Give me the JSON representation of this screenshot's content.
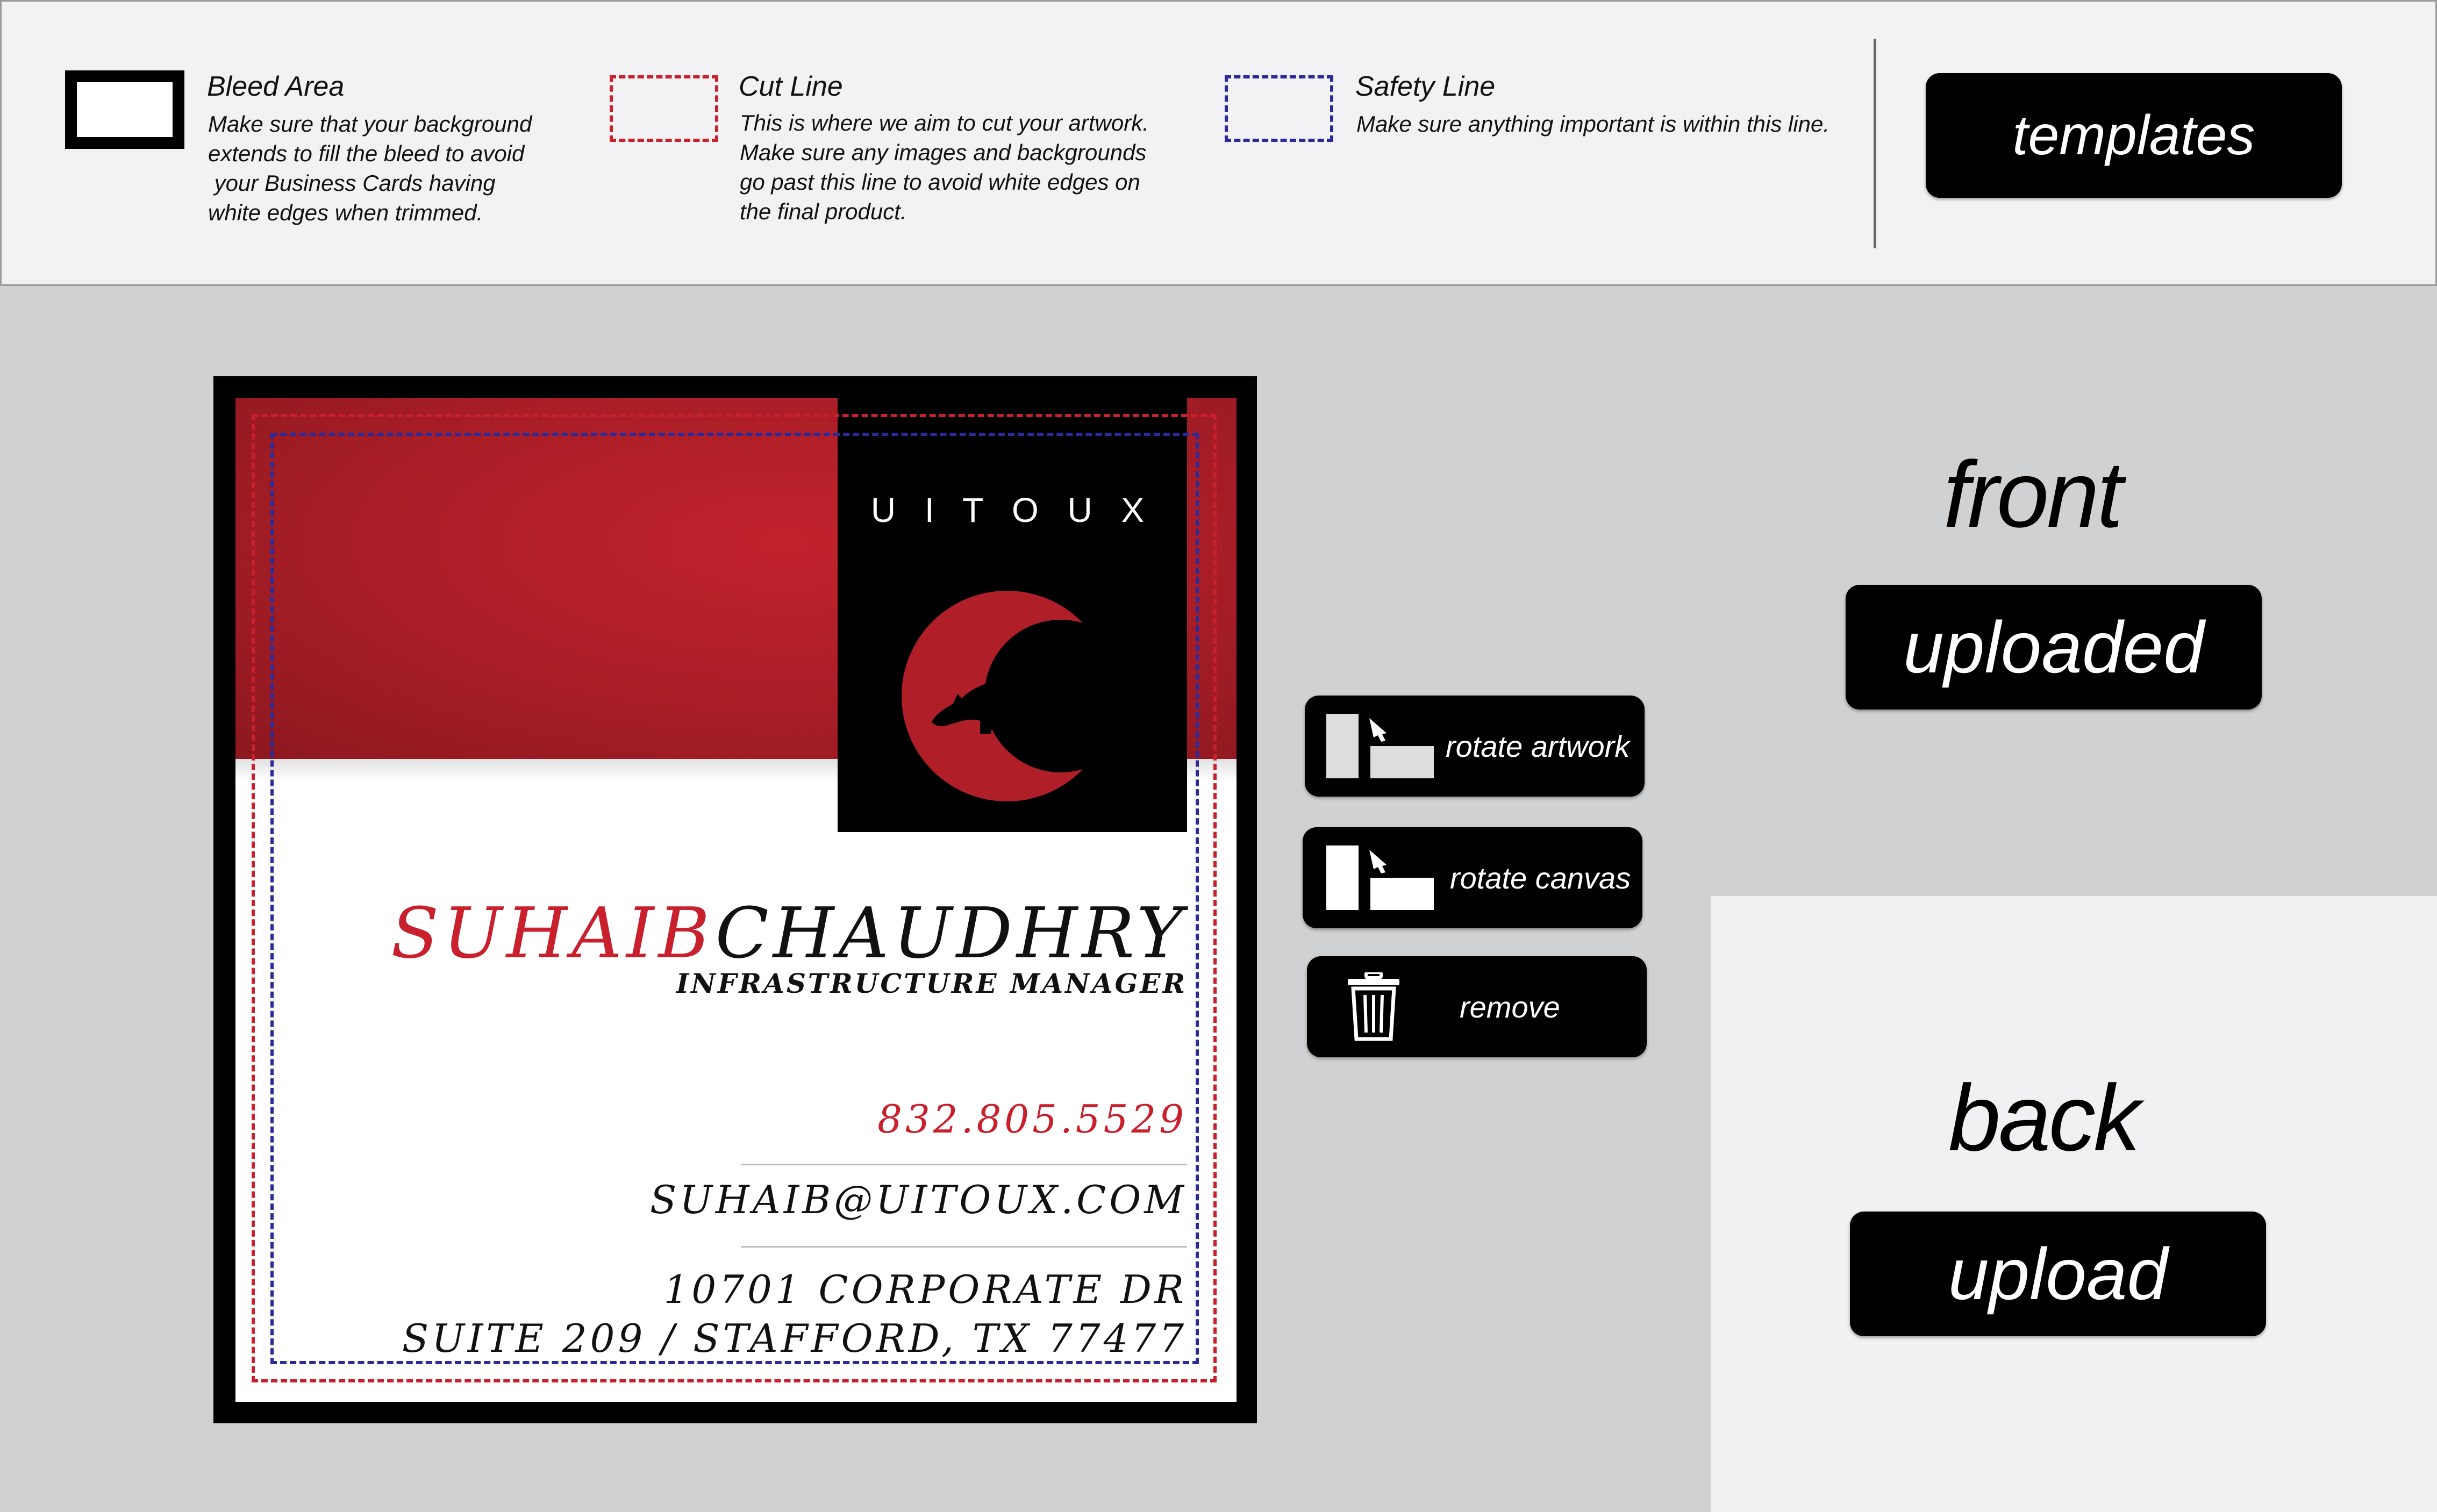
{
  "legend": {
    "bleed": {
      "title": "Bleed Area",
      "lines": [
        "Make sure that your background",
        "extends to fill the bleed to avoid",
        " your Business Cards having",
        "white edges when trimmed."
      ]
    },
    "cut": {
      "title": "Cut Line",
      "lines": [
        "This is where we aim to cut your artwork.",
        "Make sure any images and backgrounds",
        "go past this line to avoid white edges on",
        "the final product."
      ]
    },
    "safety": {
      "title": "Safety Line",
      "lines": [
        "Make sure anything important is within this line."
      ]
    }
  },
  "templates_label": "templates",
  "card": {
    "brand": "U I T O U X",
    "first_name": "SUHAIB",
    "last_name": "CHAUDHRY",
    "role": "INFRASTRUCTURE MANAGER",
    "phone": "832.805.5529",
    "email": "SUHAIB@UITOUX.COM",
    "address1": "10701 CORPORATE DR",
    "address2": "SUITE 209 / STAFFORD, TX 77477"
  },
  "tools": {
    "rotate_artwork": "rotate artwork",
    "rotate_canvas": "rotate canvas",
    "remove": "remove"
  },
  "front": {
    "label": "front",
    "button": "uploaded"
  },
  "back": {
    "label": "back",
    "button": "upload"
  },
  "colors": {
    "card_red": "#b01f28",
    "cut_line": "#c8202c",
    "safety_line": "#2a2a9a",
    "header_bg": "#f2f2f4",
    "workspace_bg": "#d0d1d3"
  },
  "icons": [
    "bleed-area-icon",
    "cut-line-icon",
    "safety-line-icon",
    "bear-logo-icon",
    "rotate-artwork-icon",
    "rotate-canvas-icon",
    "trash-icon"
  ]
}
